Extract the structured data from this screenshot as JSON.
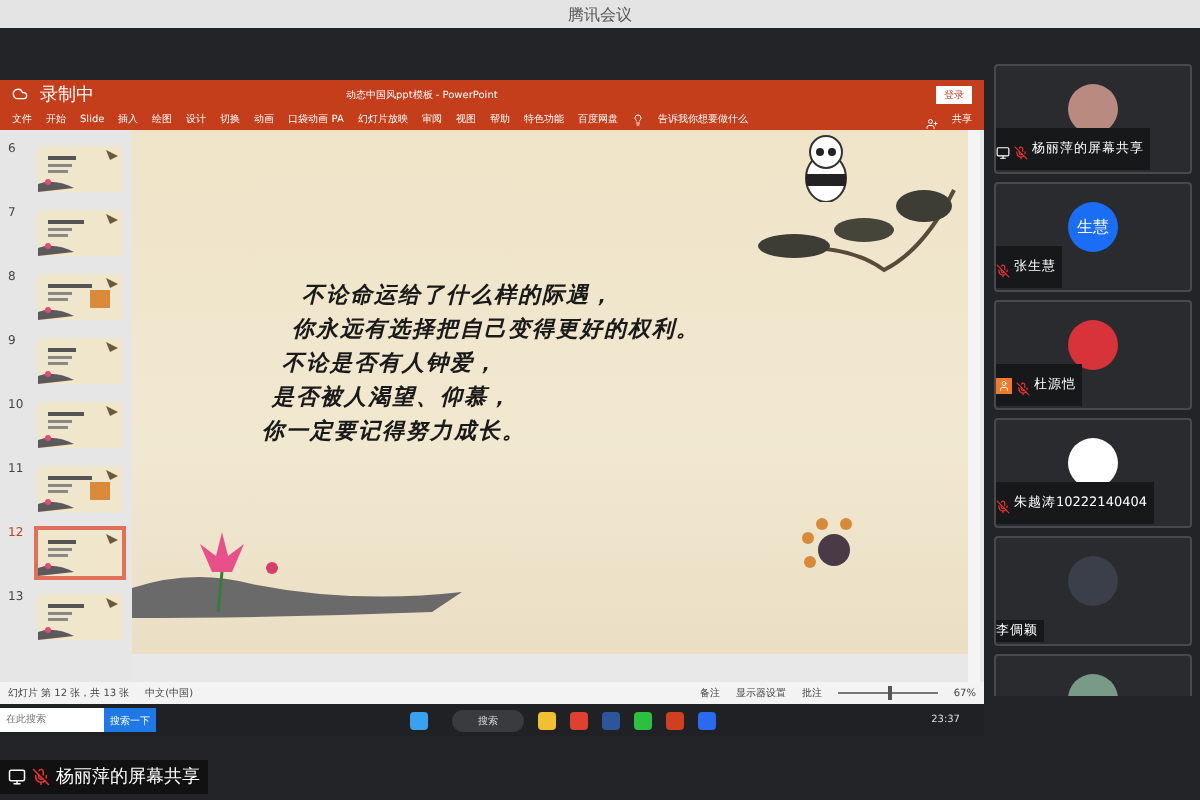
{
  "window": {
    "title": "腾讯会议"
  },
  "shared_screen": {
    "recording": {
      "label": "录制中",
      "on": true
    },
    "doc_title": "动态中国风ppt模板 - PowerPoint",
    "login_button": "登录",
    "ribbon_tabs": [
      {
        "label": "文件"
      },
      {
        "label": "开始"
      },
      {
        "label": "Slide"
      },
      {
        "label": "插入"
      },
      {
        "label": "绘图"
      },
      {
        "label": "设计"
      },
      {
        "label": "切换"
      },
      {
        "label": "动画"
      },
      {
        "label": "口袋动画 PA"
      },
      {
        "label": "幻灯片放映"
      },
      {
        "label": "审阅"
      },
      {
        "label": "视图"
      },
      {
        "label": "帮助"
      },
      {
        "label": "特色功能"
      },
      {
        "label": "百度网盘"
      }
    ],
    "tell_me": "告诉我你想要做什么",
    "share_button": "共享",
    "thumbnails": [
      {
        "number": "6",
        "selected": false
      },
      {
        "number": "7",
        "selected": false
      },
      {
        "number": "8",
        "selected": false
      },
      {
        "number": "9",
        "selected": false
      },
      {
        "number": "10",
        "selected": false
      },
      {
        "number": "11",
        "selected": false
      },
      {
        "number": "12",
        "selected": true
      },
      {
        "number": "13",
        "selected": false
      }
    ],
    "slide_lines": [
      "不论命运给了什么样的际遇，",
      "你永远有选择把自己变得更好的权利。",
      "不论是否有人钟爱，",
      "是否被人渴望、仰慕，",
      "你一定要记得努力成长。"
    ],
    "status_bar": {
      "slide_count": "幻灯片 第 12 张，共 13 张",
      "language": "中文(中国)",
      "notes": "备注",
      "display": "显示器设置",
      "comments": "批注",
      "zoom": "67%",
      "zoom_slider": {
        "level": 0.5
      }
    },
    "taskbar": {
      "placeholder": "在此搜索",
      "search_button": "搜索一下",
      "start_search": "搜索",
      "time": "23:37"
    }
  },
  "share_label": "杨丽萍的屏幕共享",
  "participants": [
    {
      "name": "杨丽萍的屏幕共享",
      "muted": true,
      "sharing": true,
      "host": false,
      "color": "#b98a80"
    },
    {
      "name": "张生慧",
      "avatar_text": "生慧",
      "muted": true,
      "sharing": false,
      "host": false,
      "color": "#1a6ef5"
    },
    {
      "name": "杜源恺",
      "muted": true,
      "sharing": false,
      "host": true,
      "color": "#d8323a"
    },
    {
      "name": "朱越涛10222140404",
      "muted": true,
      "sharing": false,
      "host": false,
      "color": "#ffffff"
    },
    {
      "name": "李倜颖",
      "muted": false,
      "sharing": false,
      "host": false,
      "color": "#3a3f4a"
    },
    {
      "sharing": false,
      "muted": false,
      "host": false,
      "color": "#7a9a88"
    }
  ]
}
